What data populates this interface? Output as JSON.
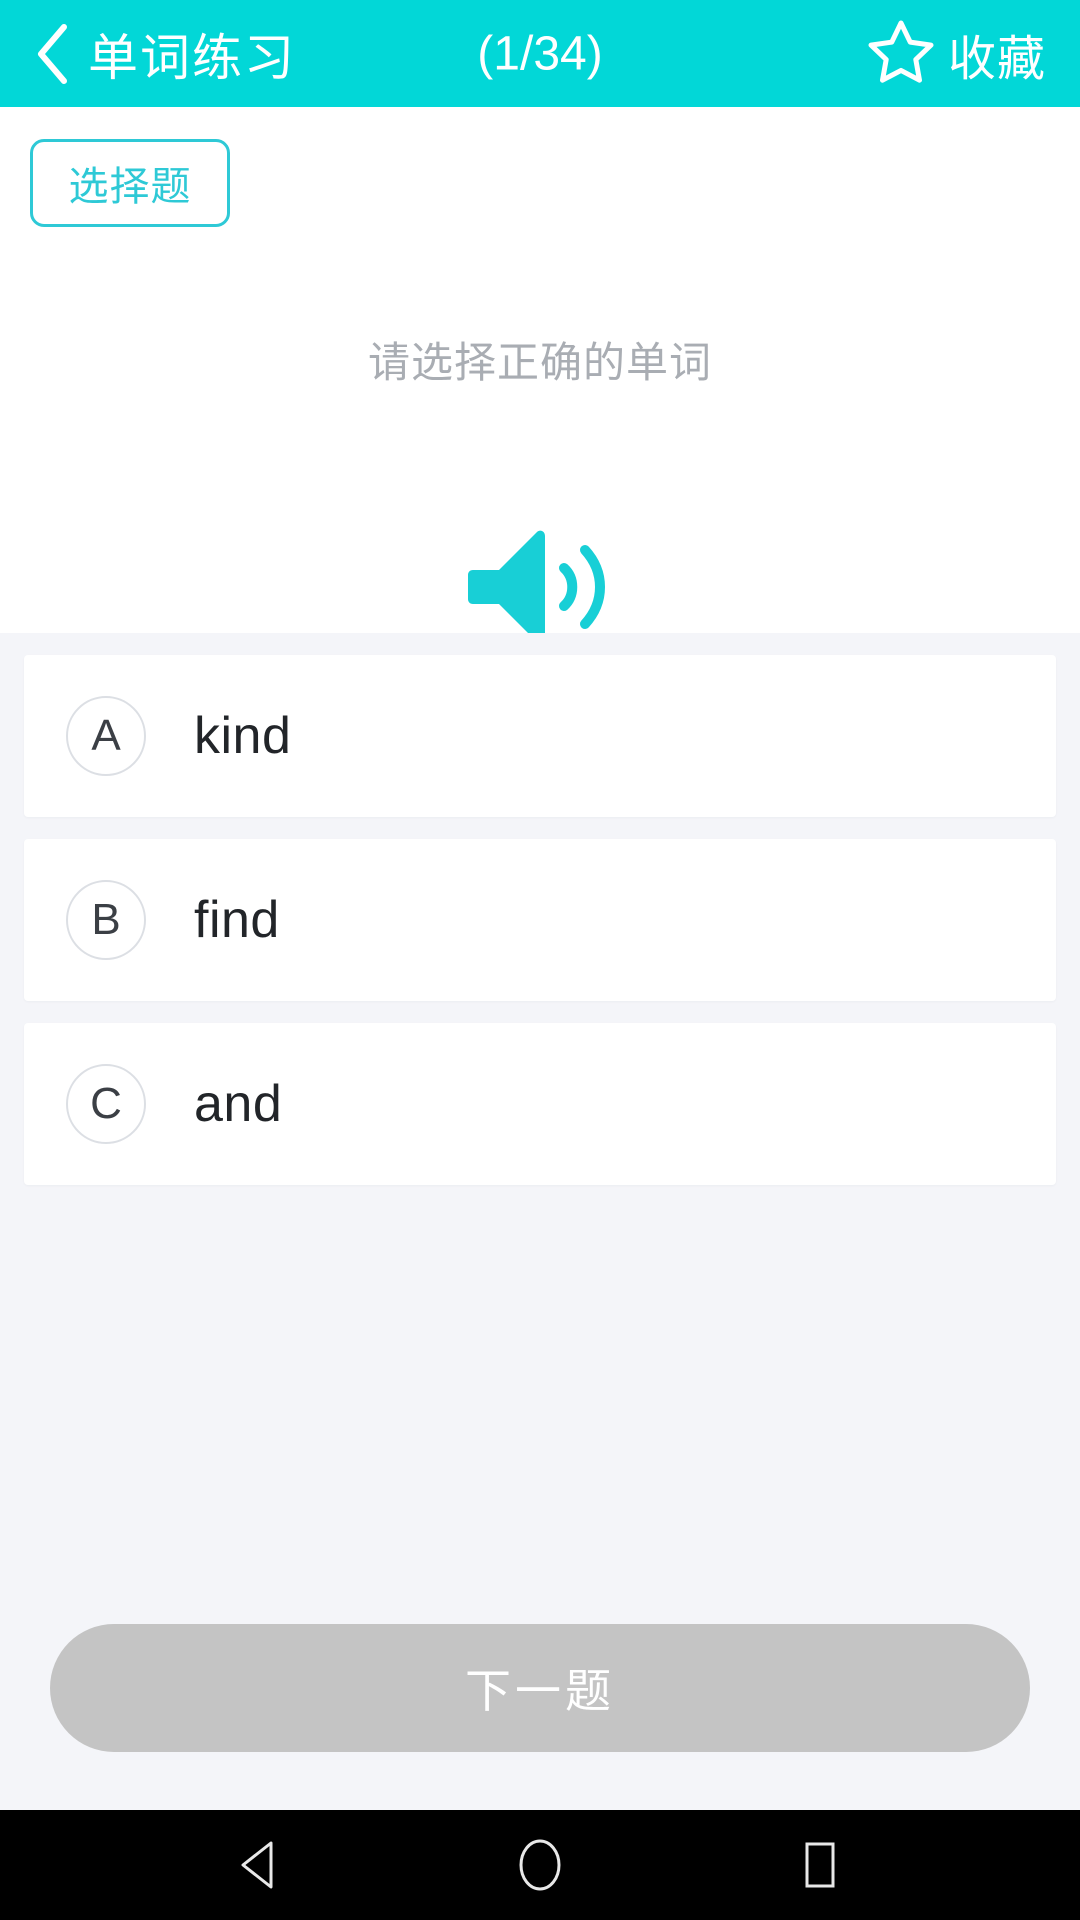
{
  "header": {
    "back_icon": "chevron-left-icon",
    "title": "单词练习",
    "counter": "(1/34)",
    "favorite_icon": "star-outline-icon",
    "favorite_label": "收藏",
    "background_color": "#02d7d7",
    "text_color": "#ffffff"
  },
  "question": {
    "type_badge": "选择题",
    "prompt": "请选择正确的单词",
    "audio_icon": "speaker-volume-icon",
    "accent_color": "#2ec9d6"
  },
  "options": [
    {
      "letter": "A",
      "word": "kind"
    },
    {
      "letter": "B",
      "word": "find"
    },
    {
      "letter": "C",
      "word": "and"
    }
  ],
  "footer": {
    "next_label": "下一题",
    "next_enabled": false,
    "next_color": "#c4c4c4"
  },
  "navbar": {
    "back_icon": "triangle-back-icon",
    "home_icon": "circle-home-icon",
    "recents_icon": "square-recents-icon",
    "background_color": "#000000"
  },
  "theme": {
    "page_background": "#f4f5f9",
    "card_background": "#ffffff",
    "muted_text": "#a9adb3"
  }
}
